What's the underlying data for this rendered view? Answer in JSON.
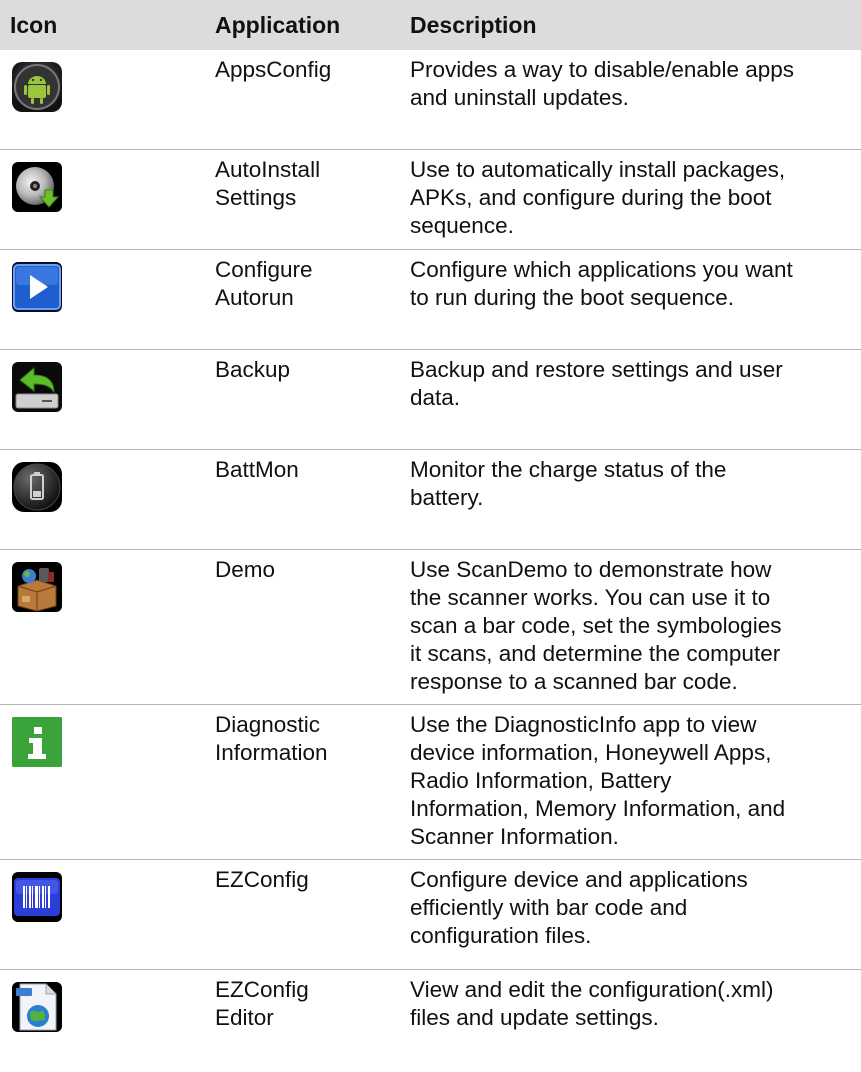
{
  "header": {
    "icon": "Icon",
    "application": "Application",
    "description": "Description"
  },
  "rows": [
    {
      "icon": "android-robot-icon",
      "app": [
        "AppsConfig"
      ],
      "desc": [
        "Provides a way to disable/enable apps",
        "and uninstall updates."
      ]
    },
    {
      "icon": "disc-download-icon",
      "app": [
        "AutoInstall",
        "Settings"
      ],
      "desc": [
        "Use to automatically install packages,",
        "APKs, and configure during the boot",
        "sequence."
      ]
    },
    {
      "icon": "play-icon",
      "app": [
        "Configure",
        "Autorun"
      ],
      "desc": [
        "Configure which applications you want",
        "to run during the boot sequence."
      ]
    },
    {
      "icon": "backup-arrow-icon",
      "app": [
        "Backup"
      ],
      "desc": [
        "Backup and restore settings and user",
        "data."
      ]
    },
    {
      "icon": "battery-icon",
      "app": [
        "BattMon"
      ],
      "desc": [
        "Monitor the charge status of the",
        "battery."
      ]
    },
    {
      "icon": "demo-box-icon",
      "app": [
        "Demo"
      ],
      "desc": [
        "Use ScanDemo to demonstrate how",
        "the scanner works. You can use it to",
        "scan a bar code, set the symbologies",
        "it scans, and determine the computer",
        "response to a scanned bar code."
      ]
    },
    {
      "icon": "info-icon",
      "app": [
        "Diagnostic",
        "Information"
      ],
      "desc": [
        "Use the DiagnosticInfo app to view",
        "device information, Honeywell Apps,",
        "Radio Information, Battery",
        "Information, Memory Information, and",
        "Scanner Information."
      ]
    },
    {
      "icon": "barcode-icon",
      "app": [
        "EZConfig"
      ],
      "desc": [
        "Configure device and applications",
        "efficiently with bar code and",
        "configuration files."
      ]
    },
    {
      "icon": "xml-document-icon",
      "app": [
        "EZConfig",
        "Editor"
      ],
      "desc": [
        "View and edit the configuration(.xml)",
        "files and update settings."
      ]
    }
  ],
  "colors": {
    "header_bg": "#dcdcdc",
    "rule": "#b5b5b5",
    "info_green": "#2e9a2e"
  }
}
